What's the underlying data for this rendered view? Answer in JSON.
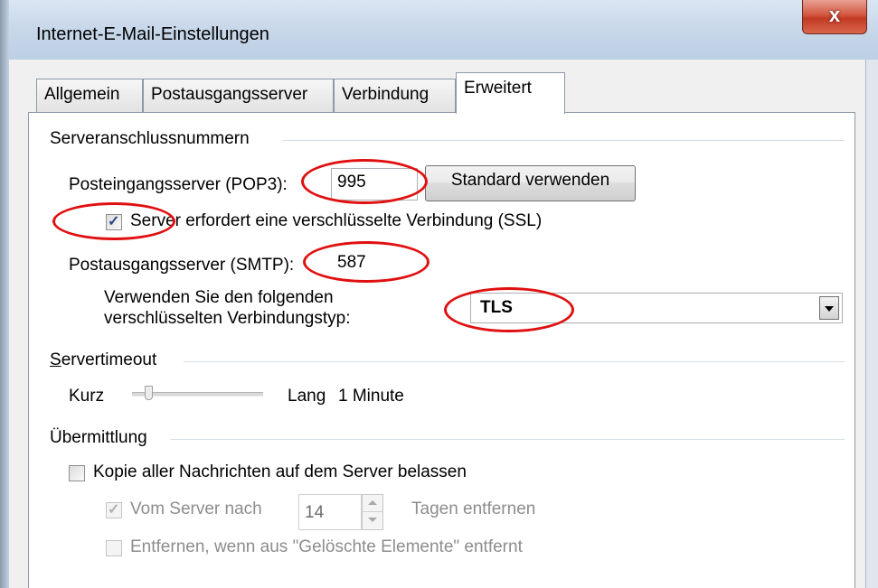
{
  "window": {
    "title": "Internet-E-Mail-Einstellungen",
    "close_glyph": "x"
  },
  "tabs": [
    {
      "label": "Allgemein"
    },
    {
      "label": "Postausgangsserver"
    },
    {
      "label": "Verbindung"
    },
    {
      "label": "Erweitert"
    }
  ],
  "server_ports": {
    "group_label": "Serveranschlussnummern",
    "pop3_label": "Posteingangsserver (POP3):",
    "pop3_value": "995",
    "default_button": "Standard verwenden",
    "ssl_label": "Server erfordert eine verschlüsselte Verbindung (SSL)",
    "ssl_checked": true,
    "smtp_label": "Postausgangsserver (SMTP):",
    "smtp_value": "587",
    "enc_label_line1": "Verwenden Sie den folgenden",
    "enc_label_line2": "verschlüsselten Verbindungstyp:",
    "enc_value": "TLS"
  },
  "timeout": {
    "group_label": "Servertimeout",
    "short_label": "Kurz",
    "long_label": "Lang",
    "value_label": "1 Minute",
    "slider_fraction": 0.1
  },
  "delivery": {
    "group_label": "Übermittlung",
    "keep_copy_label": "Kopie aller Nachrichten auf dem Server belassen",
    "keep_copy_checked": false,
    "remove_after_label": "Vom Server nach",
    "remove_after_checked": true,
    "days_value": "14",
    "days_suffix": "Tagen entfernen",
    "remove_deleted_label": "Entfernen, wenn aus \"Gelöschte Elemente\" entfernt",
    "remove_deleted_checked": false
  },
  "colors": {
    "annotation": "#e01010",
    "close_button": "#c13a23",
    "checkmark": "#2c4a86"
  }
}
